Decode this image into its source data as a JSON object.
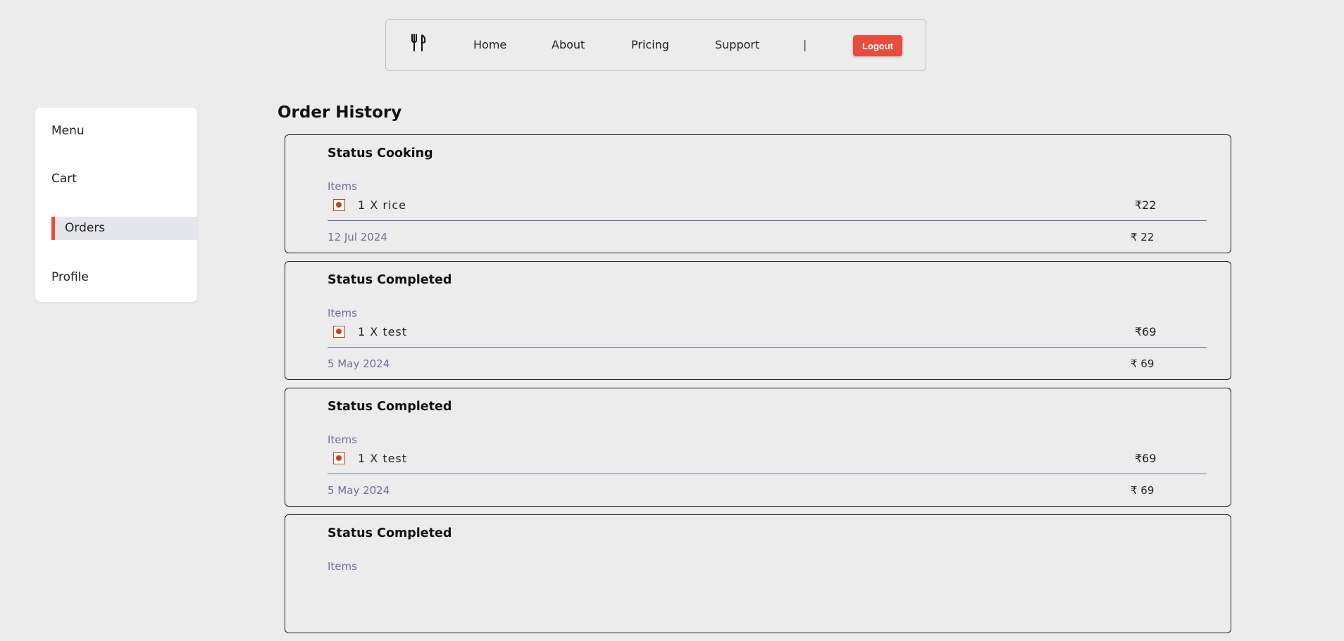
{
  "nav": {
    "logo_icon": "fork-knife-icon",
    "links": [
      "Home",
      "About",
      "Pricing",
      "Support"
    ],
    "separator": "|",
    "logout_label": "Logout",
    "accent": "#e84c3d"
  },
  "sidebar": {
    "items": [
      {
        "label": "Menu"
      },
      {
        "label": "Cart"
      },
      {
        "label": "Orders",
        "active": true
      },
      {
        "label": "Profile"
      }
    ]
  },
  "main": {
    "title": "Order History",
    "orders": [
      {
        "status": "Status Cooking",
        "items_label": "Items",
        "item": "1 X rice",
        "item_price": "₹22",
        "date": "12 Jul 2024",
        "total": "₹ 22"
      },
      {
        "status": "Status Completed",
        "items_label": "Items",
        "item": "1 X test",
        "item_price": "₹69",
        "date": "5 May 2024",
        "total": "₹ 69"
      },
      {
        "status": "Status Completed",
        "items_label": "Items",
        "item": "1 X test",
        "item_price": "₹69",
        "date": "5 May 2024",
        "total": "₹ 69"
      },
      {
        "status": "Status Completed",
        "items_label": "Items"
      }
    ]
  }
}
